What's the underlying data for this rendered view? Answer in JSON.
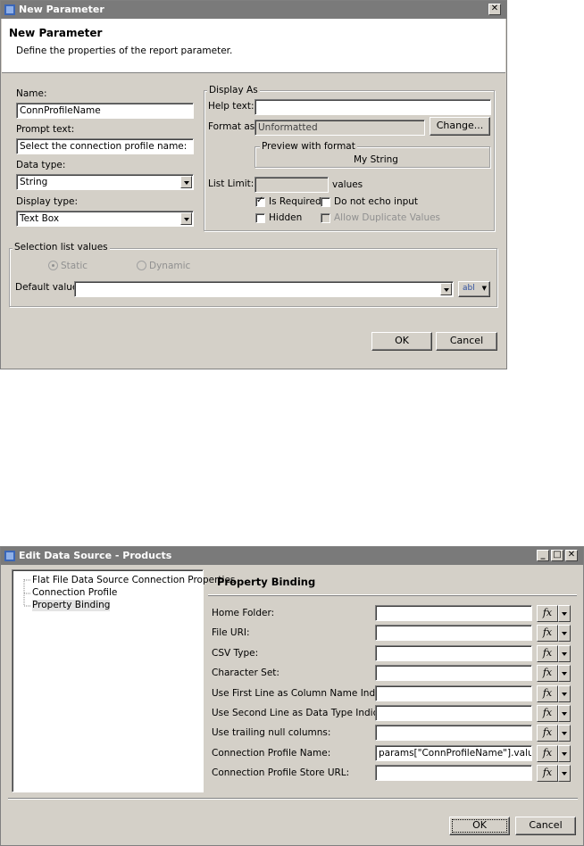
{
  "dialog1": {
    "title": "New Parameter",
    "header_title": "New Parameter",
    "header_desc": "Define the properties of the report parameter.",
    "name_label": "Name:",
    "name_value": "ConnProfileName",
    "prompt_label": "Prompt text:",
    "prompt_value": "Select the connection profile name:",
    "datatype_label": "Data type:",
    "datatype_value": "String",
    "displaytype_label": "Display type:",
    "displaytype_value": "Text Box",
    "display_as_group": "Display As",
    "help_label": "Help text:",
    "help_value": "",
    "format_label": "Format as:",
    "format_value": "Unformatted",
    "change_button": "Change...",
    "preview_group": "Preview with format",
    "preview_value": "My String",
    "list_limit_label": "List Limit:",
    "list_limit_value": "",
    "values_label": "values",
    "is_required": "Is Required",
    "is_required_checked": true,
    "no_echo": "Do not echo input",
    "hidden": "Hidden",
    "allow_dup": "Allow Duplicate Values",
    "selection_group": "Selection list values",
    "static_label": "Static",
    "dynamic_label": "Dynamic",
    "default_label": "Default value:",
    "default_value": "",
    "abl_label": "abl",
    "ok": "OK",
    "cancel": "Cancel"
  },
  "dialog2": {
    "title": "Edit Data Source - Products",
    "tree": [
      "Flat File Data Source Connection Properties",
      "Connection Profile",
      "Property Binding"
    ],
    "section_title": "Property Binding",
    "fx_label": "fx",
    "properties": [
      {
        "label": "Home Folder:",
        "value": ""
      },
      {
        "label": "File URI:",
        "value": ""
      },
      {
        "label": "CSV Type:",
        "value": ""
      },
      {
        "label": "Character Set:",
        "value": ""
      },
      {
        "label": "Use First Line as Column Name Indicator:",
        "value": ""
      },
      {
        "label": "Use Second Line as Data Type Indicator:",
        "value": ""
      },
      {
        "label": "Use trailing null columns:",
        "value": ""
      },
      {
        "label": "Connection Profile Name:",
        "value": "params[\"ConnProfileName\"].value"
      },
      {
        "label": "Connection Profile Store URL:",
        "value": ""
      }
    ],
    "ok": "OK",
    "cancel": "Cancel"
  }
}
